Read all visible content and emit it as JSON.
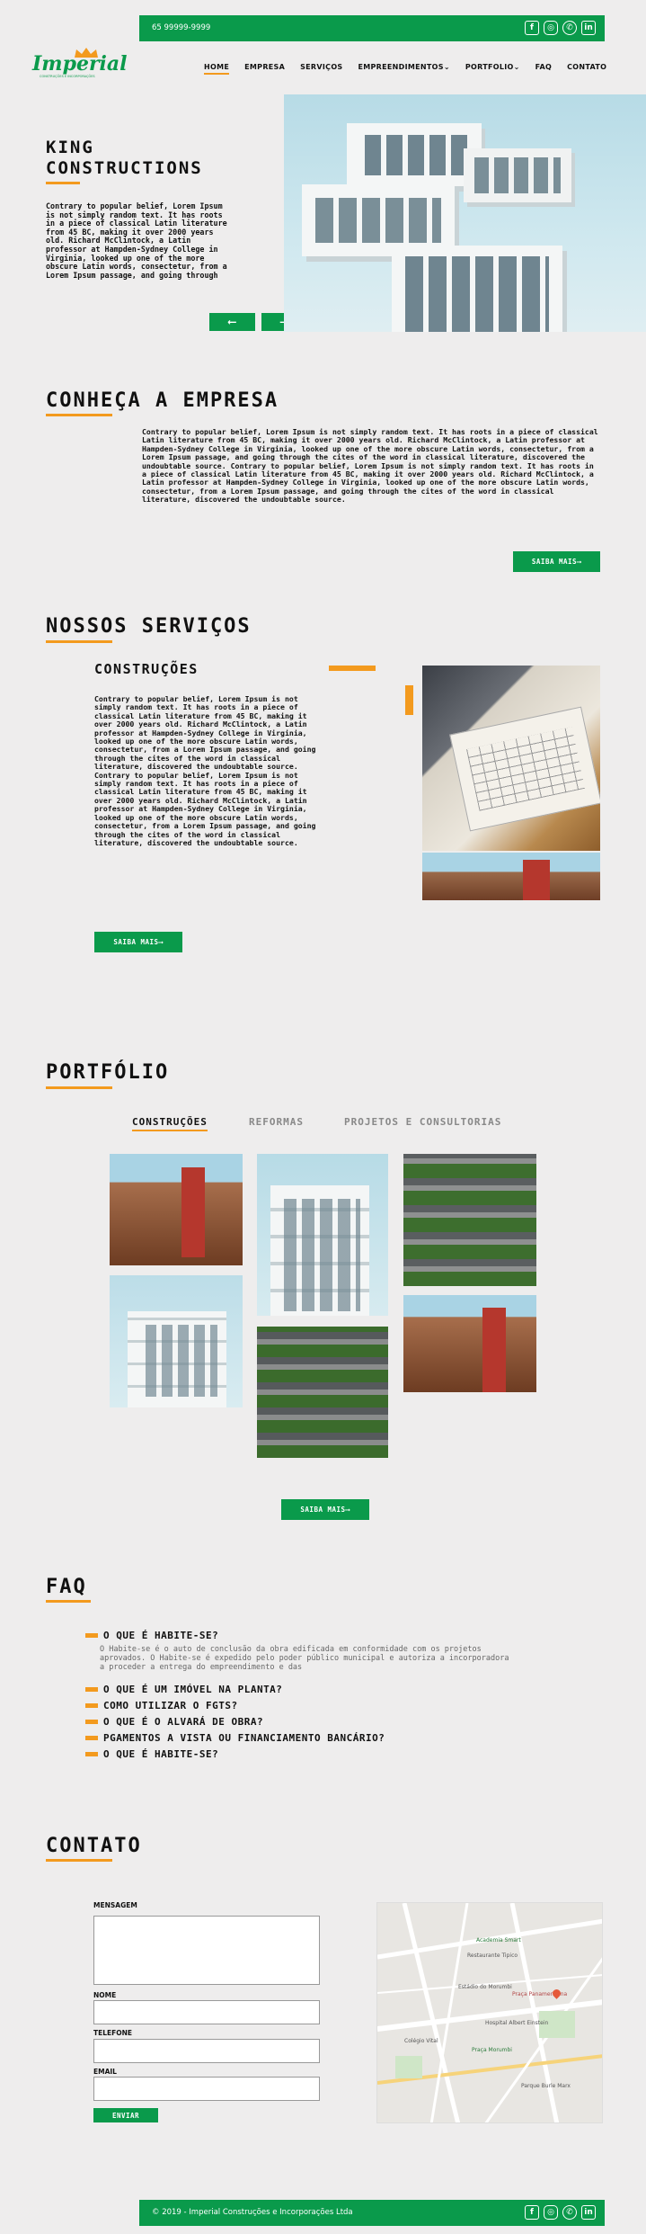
{
  "topbar": {
    "phone": "65 99999-9999"
  },
  "brand": {
    "logo": "Imperial",
    "tagline": "CONSTRUÇÕES E INCORPORAÇÕES"
  },
  "nav": {
    "items": [
      "HOME",
      "EMPRESA",
      "SERVIÇOS",
      "EMPREENDIMENTOS",
      "PORTFOLIO",
      "FAQ",
      "CONTATO"
    ],
    "dropdown_icon": "chevron-down-icon"
  },
  "hero": {
    "title_l1": "KING",
    "title_l2": "CONSTRUCTIONS",
    "text": "Contrary to popular belief, Lorem Ipsum is not simply random text. It has roots in a piece of classical Latin literature from 45 BC, making it over 2000 years old. Richard McClintock, a Latin professor at Hampden-Sydney College in Virginia, looked up one of the more obscure Latin words, consectetur, from a Lorem Ipsum passage, and going through",
    "prev": "⟵",
    "next": "⟶"
  },
  "empresa": {
    "title": "CONHEÇA A EMPRESA",
    "text": "Contrary to popular belief, Lorem Ipsum is not simply random text. It has roots in a piece of classical Latin literature from 45 BC, making it over 2000 years old. Richard McClintock, a Latin professor at Hampden-Sydney College in Virginia, looked up one of the more obscure Latin words, consectetur, from a Lorem Ipsum passage, and going through the cites of the word in classical literature, discovered the undoubtable source. Contrary to popular belief, Lorem Ipsum is not simply random text. It has roots in a piece of classical Latin literature from 45 BC, making it over 2000 years old. Richard McClintock, a Latin professor at Hampden-Sydney College in Virginia, looked up one of the more obscure Latin words, consectetur, from a Lorem Ipsum passage, and going through the cites of the word in classical literature, discovered the undoubtable source.",
    "button": "SAIBA MAIS⟶"
  },
  "servicos": {
    "title": "NOSSOS SERVIÇOS",
    "subtitle": "CONSTRUÇÕES",
    "text": "Contrary to popular belief, Lorem Ipsum is not simply random text. It has roots in a piece of classical Latin literature from 45 BC, making it over 2000 years old. Richard McClintock, a Latin professor at Hampden-Sydney College in Virginia, looked up one of the more obscure Latin words, consectetur, from a Lorem Ipsum passage, and going through the cites of the word in classical literature, discovered the undoubtable source. Contrary to popular belief, Lorem Ipsum is not simply random text. It has roots in a piece of classical Latin literature from 45 BC, making it over 2000 years old. Richard McClintock, a Latin professor at Hampden-Sydney College in Virginia, looked up one of the more obscure Latin words, consectetur, from a Lorem Ipsum passage, and going through the cites of the word in classical literature, discovered the undoubtable source.",
    "button": "SAIBA MAIS⟶"
  },
  "portfolio": {
    "title": "PORTFÓLIO",
    "tabs": [
      "CONSTRUÇÕES",
      "REFORMAS",
      "PROJETOS E CONSULTORIAS"
    ],
    "button": "SAIBA MAIS⟶"
  },
  "faq": {
    "title": "FAQ",
    "items": [
      "O QUE É HABITE-SE?",
      "O QUE É UM IMÓVEL NA PLANTA?",
      "COMO UTILIZAR O FGTS?",
      "O QUE É O ALVARÁ DE OBRA?",
      "PGAMENTOS A VISTA OU FINANCIAMENTO BANCÁRIO?",
      "O QUE É HABITE-SE?"
    ],
    "answer": "O Habite-se é o auto de conclusão da obra edificada em conformidade com os projetos aprovados. O Habite-se é expedido pelo poder público municipal e autoriza a incorporadora a proceder a entrega do empreendimento e das"
  },
  "contato": {
    "title": "CONTATO",
    "labels": {
      "mensagem": "MENSAGEM",
      "nome": "NOME",
      "telefone": "TELEFONE",
      "email": "EMAIL"
    },
    "button": "ENVIAR",
    "map_labels": [
      "Academia Smart",
      "Restaurante Tipico",
      "Estádio do Morumbi",
      "Praça Panamericana",
      "Hospital Albert Einstein",
      "Colégio Vital",
      "Praça Morumbi",
      "Parque Burle Marx"
    ]
  },
  "footer": {
    "copyright": "© 2019 - Imperial Construções e Incorporações Ltda"
  },
  "colors": {
    "green": "#0a9a4b",
    "orange": "#f39a1e",
    "bg": "#eeeded"
  }
}
